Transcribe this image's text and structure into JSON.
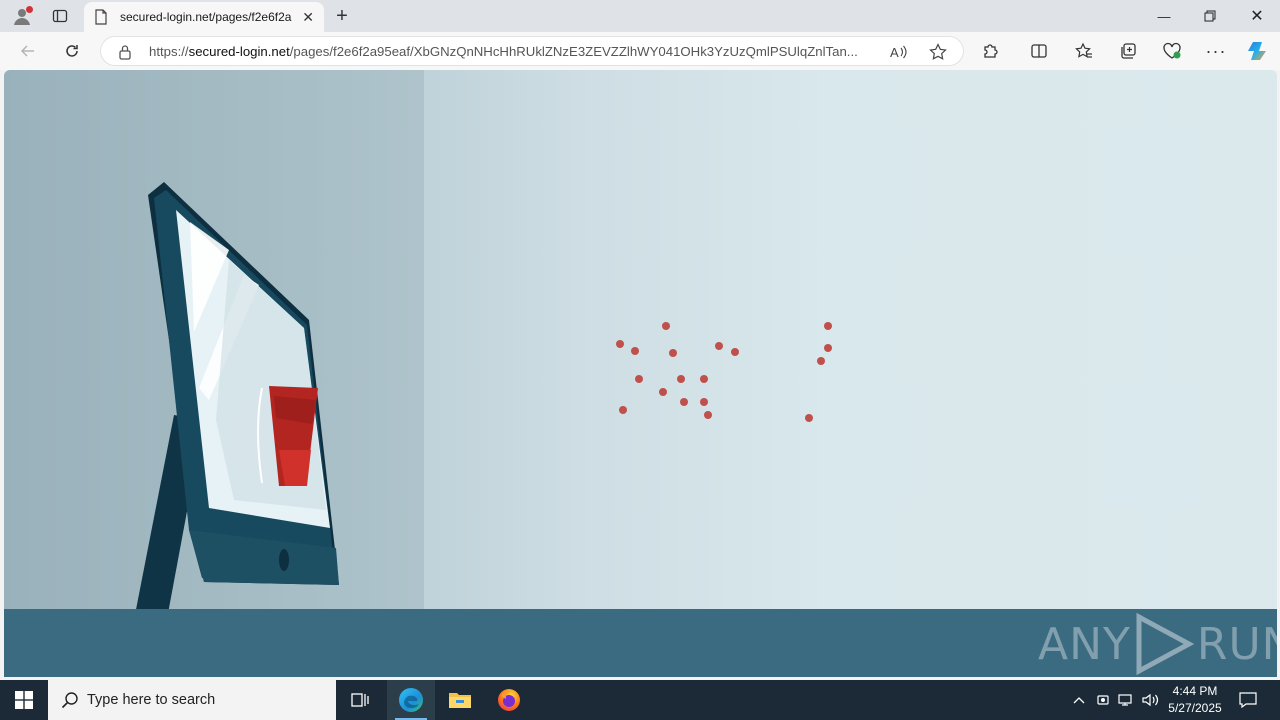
{
  "browser": {
    "tab_title": "secured-login.net/pages/f2e6f2a",
    "url_host": "secured-login.net",
    "url_scheme": "https://",
    "url_path": "/pages/f2e6f2a95eaf/XbGNzQnNHcHhRUklZNzE3ZEVZZlhWY041OHk3YzUzQmlPSUlqZnlTan..."
  },
  "page": {
    "watermark_left": "ANY",
    "watermark_right": "RUN",
    "accent_red": "#b7413c",
    "dot_color": "#c0504b",
    "floor_color": "#3b6b80"
  },
  "taskbar": {
    "search_placeholder": "Type here to search",
    "time": "4:44 PM",
    "date": "5/27/2025"
  }
}
